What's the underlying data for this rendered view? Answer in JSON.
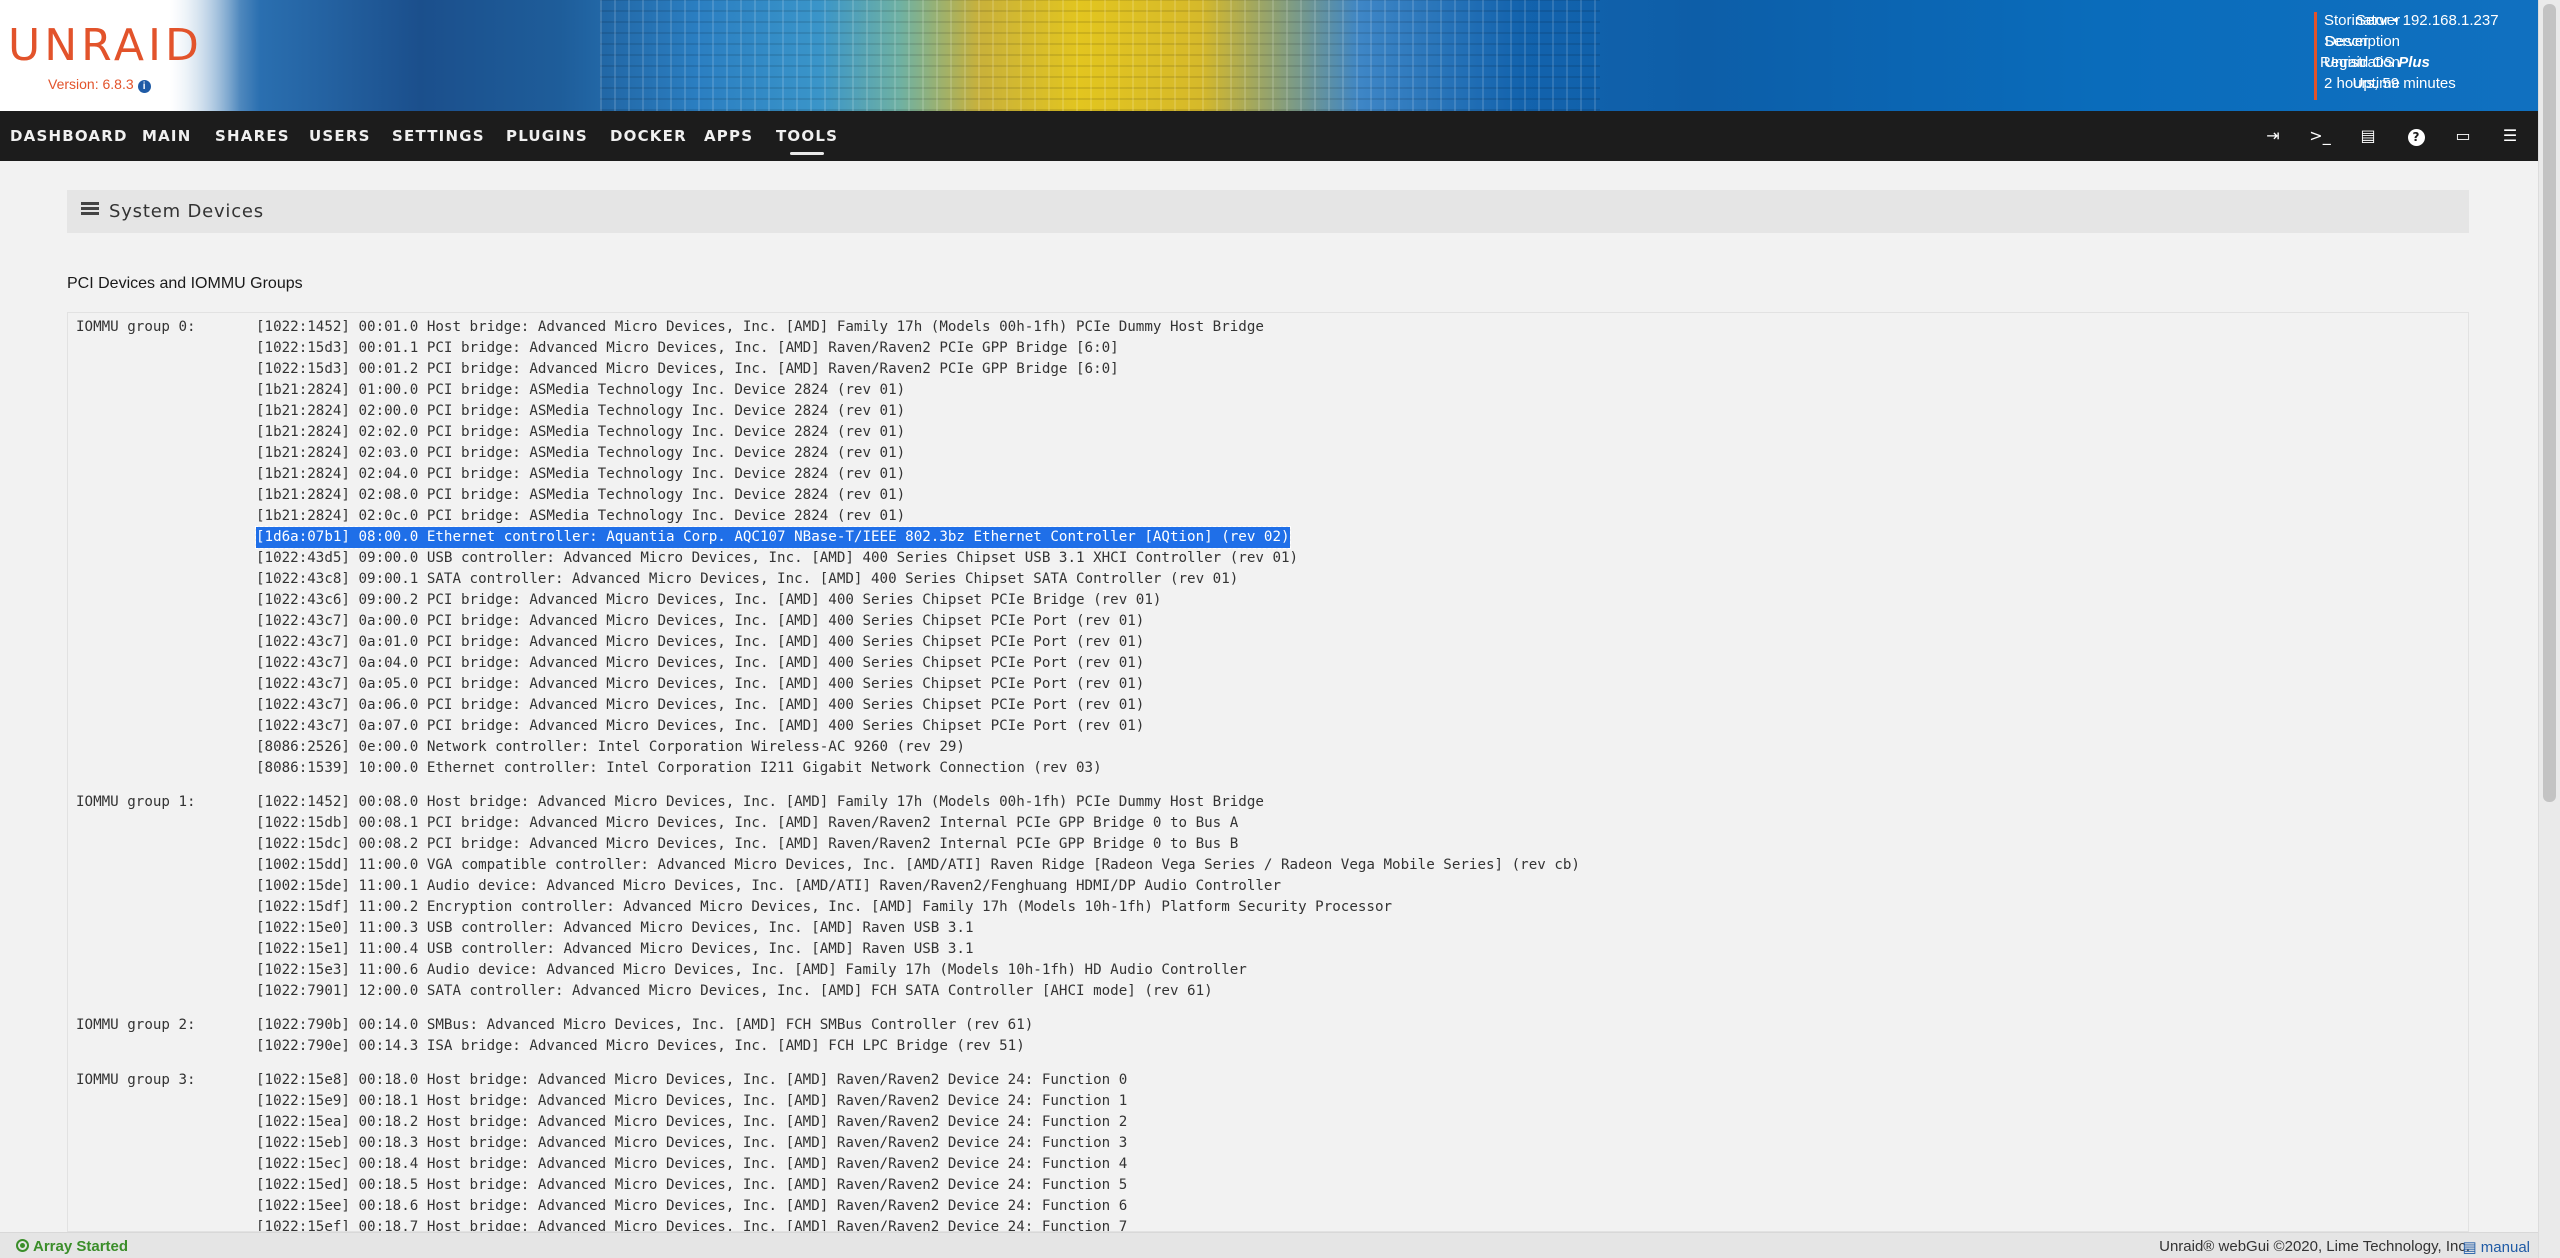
{
  "brand": {
    "logo": "UNRAID",
    "version": "Version: 6.8.3",
    "version_info_icon": "info-icon"
  },
  "server_info": {
    "rows": [
      {
        "label": "Server",
        "value": "Storinator • 192.168.1.237",
        "em": ""
      },
      {
        "label": "Description",
        "value": "Server",
        "em": ""
      },
      {
        "label": "Registration",
        "value": "Unraid OS ",
        "em": "Plus"
      },
      {
        "label": "Uptime",
        "value": "2 hours, 59 minutes",
        "em": ""
      }
    ],
    "accent_color": "#e2532b"
  },
  "nav": {
    "items": [
      "DASHBOARD",
      "MAIN",
      "SHARES",
      "USERS",
      "SETTINGS",
      "PLUGINS",
      "DOCKER",
      "APPS",
      "TOOLS"
    ],
    "active": "TOOLS",
    "icons": [
      "logout-icon",
      "terminal-icon",
      "log-icon",
      "help-icon",
      "display-icon",
      "menu-icon"
    ]
  },
  "page": {
    "title": "System Devices",
    "section_title": "PCI Devices and IOMMU Groups"
  },
  "iommu_groups": [
    {
      "label": "IOMMU group 0:",
      "devices": [
        "[1022:1452] 00:01.0 Host bridge: Advanced Micro Devices, Inc. [AMD] Family 17h (Models 00h-1fh) PCIe Dummy Host Bridge",
        "[1022:15d3] 00:01.1 PCI bridge: Advanced Micro Devices, Inc. [AMD] Raven/Raven2 PCIe GPP Bridge [6:0]",
        "[1022:15d3] 00:01.2 PCI bridge: Advanced Micro Devices, Inc. [AMD] Raven/Raven2 PCIe GPP Bridge [6:0]",
        "[1b21:2824] 01:00.0 PCI bridge: ASMedia Technology Inc. Device 2824 (rev 01)",
        "[1b21:2824] 02:00.0 PCI bridge: ASMedia Technology Inc. Device 2824 (rev 01)",
        "[1b21:2824] 02:02.0 PCI bridge: ASMedia Technology Inc. Device 2824 (rev 01)",
        "[1b21:2824] 02:03.0 PCI bridge: ASMedia Technology Inc. Device 2824 (rev 01)",
        "[1b21:2824] 02:04.0 PCI bridge: ASMedia Technology Inc. Device 2824 (rev 01)",
        "[1b21:2824] 02:08.0 PCI bridge: ASMedia Technology Inc. Device 2824 (rev 01)",
        "[1b21:2824] 02:0c.0 PCI bridge: ASMedia Technology Inc. Device 2824 (rev 01)",
        "[1d6a:07b1] 08:00.0 Ethernet controller: Aquantia Corp. AQC107 NBase-T/IEEE 802.3bz Ethernet Controller [AQtion] (rev 02)",
        "[1022:43d5] 09:00.0 USB controller: Advanced Micro Devices, Inc. [AMD] 400 Series Chipset USB 3.1 XHCI Controller (rev 01)",
        "[1022:43c8] 09:00.1 SATA controller: Advanced Micro Devices, Inc. [AMD] 400 Series Chipset SATA Controller (rev 01)",
        "[1022:43c6] 09:00.2 PCI bridge: Advanced Micro Devices, Inc. [AMD] 400 Series Chipset PCIe Bridge (rev 01)",
        "[1022:43c7] 0a:00.0 PCI bridge: Advanced Micro Devices, Inc. [AMD] 400 Series Chipset PCIe Port (rev 01)",
        "[1022:43c7] 0a:01.0 PCI bridge: Advanced Micro Devices, Inc. [AMD] 400 Series Chipset PCIe Port (rev 01)",
        "[1022:43c7] 0a:04.0 PCI bridge: Advanced Micro Devices, Inc. [AMD] 400 Series Chipset PCIe Port (rev 01)",
        "[1022:43c7] 0a:05.0 PCI bridge: Advanced Micro Devices, Inc. [AMD] 400 Series Chipset PCIe Port (rev 01)",
        "[1022:43c7] 0a:06.0 PCI bridge: Advanced Micro Devices, Inc. [AMD] 400 Series Chipset PCIe Port (rev 01)",
        "[1022:43c7] 0a:07.0 PCI bridge: Advanced Micro Devices, Inc. [AMD] 400 Series Chipset PCIe Port (rev 01)",
        "[8086:2526] 0e:00.0 Network controller: Intel Corporation Wireless-AC 9260 (rev 29)",
        "[8086:1539] 10:00.0 Ethernet controller: Intel Corporation I211 Gigabit Network Connection (rev 03)"
      ]
    },
    {
      "label": "IOMMU group 1:",
      "devices": [
        "[1022:1452] 00:08.0 Host bridge: Advanced Micro Devices, Inc. [AMD] Family 17h (Models 00h-1fh) PCIe Dummy Host Bridge",
        "[1022:15db] 00:08.1 PCI bridge: Advanced Micro Devices, Inc. [AMD] Raven/Raven2 Internal PCIe GPP Bridge 0 to Bus A",
        "[1022:15dc] 00:08.2 PCI bridge: Advanced Micro Devices, Inc. [AMD] Raven/Raven2 Internal PCIe GPP Bridge 0 to Bus B",
        "[1002:15dd] 11:00.0 VGA compatible controller: Advanced Micro Devices, Inc. [AMD/ATI] Raven Ridge [Radeon Vega Series / Radeon Vega Mobile Series] (rev cb)",
        "[1002:15de] 11:00.1 Audio device: Advanced Micro Devices, Inc. [AMD/ATI] Raven/Raven2/Fenghuang HDMI/DP Audio Controller",
        "[1022:15df] 11:00.2 Encryption controller: Advanced Micro Devices, Inc. [AMD] Family 17h (Models 10h-1fh) Platform Security Processor",
        "[1022:15e0] 11:00.3 USB controller: Advanced Micro Devices, Inc. [AMD] Raven USB 3.1",
        "[1022:15e1] 11:00.4 USB controller: Advanced Micro Devices, Inc. [AMD] Raven USB 3.1",
        "[1022:15e3] 11:00.6 Audio device: Advanced Micro Devices, Inc. [AMD] Family 17h (Models 10h-1fh) HD Audio Controller",
        "[1022:7901] 12:00.0 SATA controller: Advanced Micro Devices, Inc. [AMD] FCH SATA Controller [AHCI mode] (rev 61)"
      ]
    },
    {
      "label": "IOMMU group 2:",
      "devices": [
        "[1022:790b] 00:14.0 SMBus: Advanced Micro Devices, Inc. [AMD] FCH SMBus Controller (rev 61)",
        "[1022:790e] 00:14.3 ISA bridge: Advanced Micro Devices, Inc. [AMD] FCH LPC Bridge (rev 51)"
      ]
    },
    {
      "label": "IOMMU group 3:",
      "devices": [
        "[1022:15e8] 00:18.0 Host bridge: Advanced Micro Devices, Inc. [AMD] Raven/Raven2 Device 24: Function 0",
        "[1022:15e9] 00:18.1 Host bridge: Advanced Micro Devices, Inc. [AMD] Raven/Raven2 Device 24: Function 1",
        "[1022:15ea] 00:18.2 Host bridge: Advanced Micro Devices, Inc. [AMD] Raven/Raven2 Device 24: Function 2",
        "[1022:15eb] 00:18.3 Host bridge: Advanced Micro Devices, Inc. [AMD] Raven/Raven2 Device 24: Function 3",
        "[1022:15ec] 00:18.4 Host bridge: Advanced Micro Devices, Inc. [AMD] Raven/Raven2 Device 24: Function 4",
        "[1022:15ed] 00:18.5 Host bridge: Advanced Micro Devices, Inc. [AMD] Raven/Raven2 Device 24: Function 5",
        "[1022:15ee] 00:18.6 Host bridge: Advanced Micro Devices, Inc. [AMD] Raven/Raven2 Device 24: Function 6",
        "[1022:15ef] 00:18.7 Host bridge: Advanced Micro Devices, Inc. [AMD] Raven/Raven2 Device 24: Function 7"
      ]
    }
  ],
  "selected_device": "[1d6a:07b1] 08:00.0 Ethernet controller: Aquantia Corp. AQC107 NBase-T/IEEE 802.3bz Ethernet Controller [AQtion] (rev 02)",
  "footer": {
    "array_status": "Array Started",
    "status_color": "#3b8e2a",
    "copyright": "Unraid® webGui ©2020, Lime Technology, Inc.",
    "manual_label": "manual"
  }
}
